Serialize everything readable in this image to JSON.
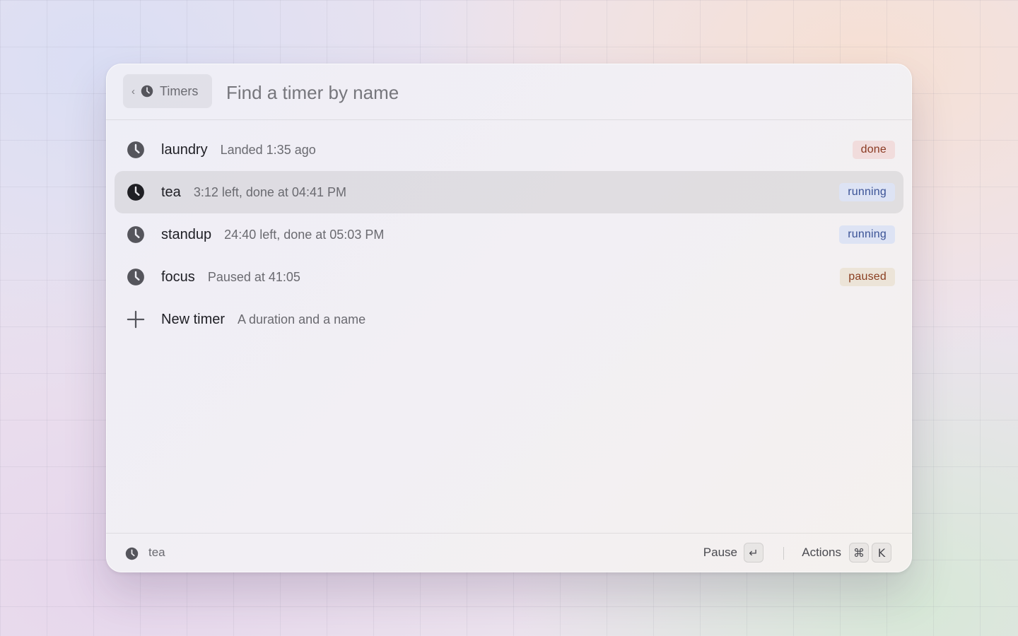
{
  "header": {
    "back_label": "Timers",
    "back_chevron": "‹",
    "search_placeholder": "Find a timer by name",
    "search_value": ""
  },
  "timers": [
    {
      "title": "laundry",
      "subtitle": "Landed 1:35 ago",
      "status": "done",
      "selected": false,
      "icon": "clock-icon"
    },
    {
      "title": "tea",
      "subtitle": "3:12 left, done at 04:41 PM",
      "status": "running",
      "selected": true,
      "icon": "clock-icon"
    },
    {
      "title": "standup",
      "subtitle": "24:40 left, done at 05:03 PM",
      "status": "running",
      "selected": false,
      "icon": "clock-icon"
    },
    {
      "title": "focus",
      "subtitle": "Paused at 41:05",
      "status": "paused",
      "selected": false,
      "icon": "clock-icon"
    }
  ],
  "new_timer": {
    "title": "New timer",
    "subtitle": "A duration and a name",
    "icon": "plus-icon"
  },
  "footer": {
    "selected_label": "tea",
    "primary_action": "Pause",
    "primary_key": "↵",
    "secondary_action": "Actions",
    "secondary_keys": [
      "⌘",
      "K"
    ]
  },
  "colors": {
    "badge_done_bg": "#f1dcdc",
    "badge_done_text": "#8a3a22",
    "badge_running_bg": "#dde3f4",
    "badge_running_text": "#3a5296",
    "badge_paused_bg": "#ece4d8",
    "badge_paused_text": "#8a3e20"
  }
}
